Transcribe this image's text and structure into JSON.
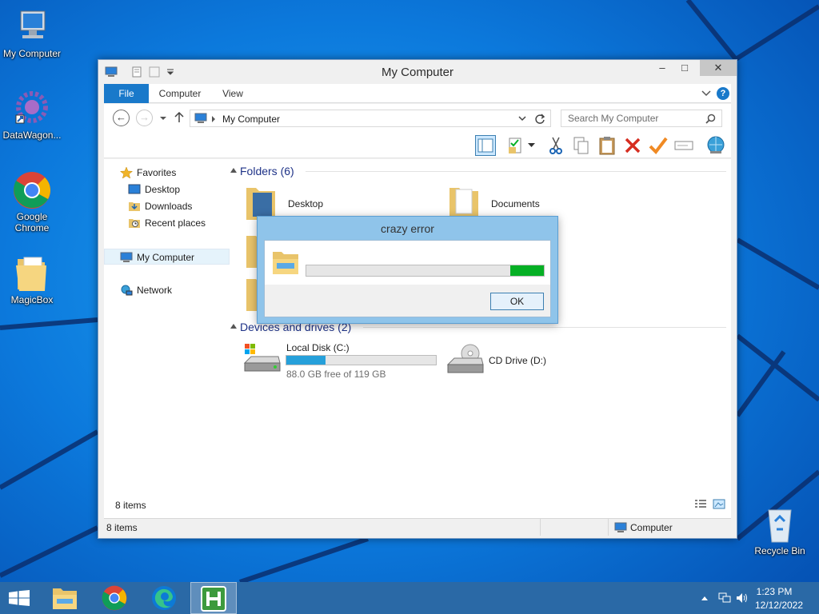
{
  "desktop": {
    "icons": [
      {
        "label": "My Computer"
      },
      {
        "label": "DataWagon..."
      },
      {
        "label": "Google Chrome"
      },
      {
        "label": "MagicBox"
      },
      {
        "label": "Recycle Bin"
      }
    ]
  },
  "window": {
    "title": "My Computer",
    "caption": {
      "minimize": "–",
      "maximize": "□",
      "close": "✕"
    },
    "tabs": [
      {
        "label": "File",
        "active": true
      },
      {
        "label": "Computer"
      },
      {
        "label": "View"
      }
    ],
    "help": "?",
    "address": {
      "path": "My Computer"
    },
    "search": {
      "placeholder": "Search My Computer"
    },
    "nav_pane": {
      "items": [
        {
          "label": "Favorites",
          "icon": "star-icon"
        },
        {
          "label": "Desktop",
          "icon": "desktop-icon"
        },
        {
          "label": "Downloads",
          "icon": "downloads-icon"
        },
        {
          "label": "Recent places",
          "icon": "recent-places-icon"
        },
        {
          "label": "My Computer",
          "icon": "computer-icon",
          "selected": true
        },
        {
          "label": "Network",
          "icon": "network-icon"
        }
      ]
    },
    "groups": {
      "folders": {
        "header": "Folders (6)",
        "items": [
          {
            "label": "Desktop"
          },
          {
            "label": "Documents"
          }
        ]
      },
      "drives": {
        "header": "Devices and drives (2)",
        "items": [
          {
            "label": "Local Disk (C:)",
            "free_text": "88.0 GB free of 119 GB",
            "used_fraction": 0.26
          },
          {
            "label": "CD Drive (D:)"
          }
        ]
      }
    },
    "status": {
      "inner_count": "8 items",
      "count": "8 items",
      "location": "Computer"
    }
  },
  "dialog": {
    "title": "crazy error",
    "progress_fraction": 0.14,
    "progress_position": "right",
    "ok_label": "OK",
    "accent": "#06b025"
  },
  "taskbar": {
    "time": "1:23 PM",
    "date": "12/12/2022",
    "apps": [
      "start-icon",
      "file-explorer-icon",
      "chrome-icon",
      "edge-icon",
      "hyperterminal-icon"
    ]
  },
  "colors": {
    "wallpaper": "#0a63c9",
    "taskbar": "#2a69a6",
    "accent": "#1979ca",
    "drive_fill": "#26a0da"
  }
}
